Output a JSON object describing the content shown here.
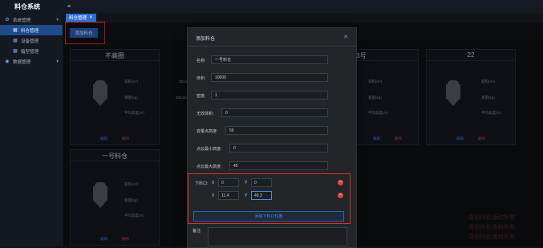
{
  "app": {
    "title": "料仓系统"
  },
  "sidebar": {
    "items": [
      {
        "label": "系统管理",
        "icon": "gear-icon"
      },
      {
        "label": "料仓管理",
        "icon": "grid-icon",
        "active": true
      },
      {
        "label": "设备管理",
        "icon": "grid-icon"
      },
      {
        "label": "箱型管理",
        "icon": "grid-icon"
      },
      {
        "label": "数据管理",
        "icon": "location-icon"
      }
    ]
  },
  "tabs": [
    {
      "label": "料仓管理"
    }
  ],
  "toolbar": {
    "add_label": "添加料仓"
  },
  "cards": [
    {
      "title": "不高圈",
      "rows": [
        {
          "label": "容积(m³)",
          "value": "331448.82"
        },
        {
          "label": "重量(kg)",
          "value": "331448.25"
        },
        {
          "label": "平均高度(m)",
          "value": "14.24"
        }
      ]
    },
    {
      "title": "1-3号",
      "rows": [
        {
          "label": "容积(m³)",
          "value": ""
        },
        {
          "label": "重量(kg)",
          "value": ""
        },
        {
          "label": "平均高度(m)",
          "value": ""
        }
      ]
    },
    {
      "title": "22",
      "rows": [
        {
          "label": "容积(m³)",
          "value": ""
        },
        {
          "label": "重量(kg)",
          "value": ""
        },
        {
          "label": "平均高度(m)",
          "value": ""
        }
      ]
    },
    {
      "title": "一号料仓",
      "rows": [
        {
          "label": "容积(m³)",
          "value": ""
        },
        {
          "label": "重量(kg)",
          "value": ""
        },
        {
          "label": "平均高度(m)",
          "value": ""
        }
      ]
    }
  ],
  "card_actions": {
    "edit": "编辑",
    "delete": "删除"
  },
  "modal": {
    "title": "添加料仓",
    "fields": [
      {
        "label": "名称:",
        "value": "一号料仓"
      },
      {
        "label": "体积:",
        "value": "10000"
      },
      {
        "label": "密度:",
        "value": "1"
      },
      {
        "label": "无效体积:",
        "value": "0"
      },
      {
        "label": "容量点高度:",
        "value": "56"
      },
      {
        "label": "点云最小高度:",
        "value": "0"
      },
      {
        "label": "点云最大高度:",
        "value": "45"
      }
    ],
    "outlet": {
      "label": "下料口:",
      "rows": [
        {
          "x": "0",
          "y": "0"
        },
        {
          "x": "11.4",
          "y": "40.3"
        }
      ],
      "x_label": "X",
      "y_label": "Y",
      "add_label": "添加下料口位置"
    },
    "remark_label": "备注:"
  },
  "watermark": {
    "lines": [
      "原创作品 版权所有",
      "原创作品 版权所有",
      "原创作品 版权所有"
    ]
  }
}
